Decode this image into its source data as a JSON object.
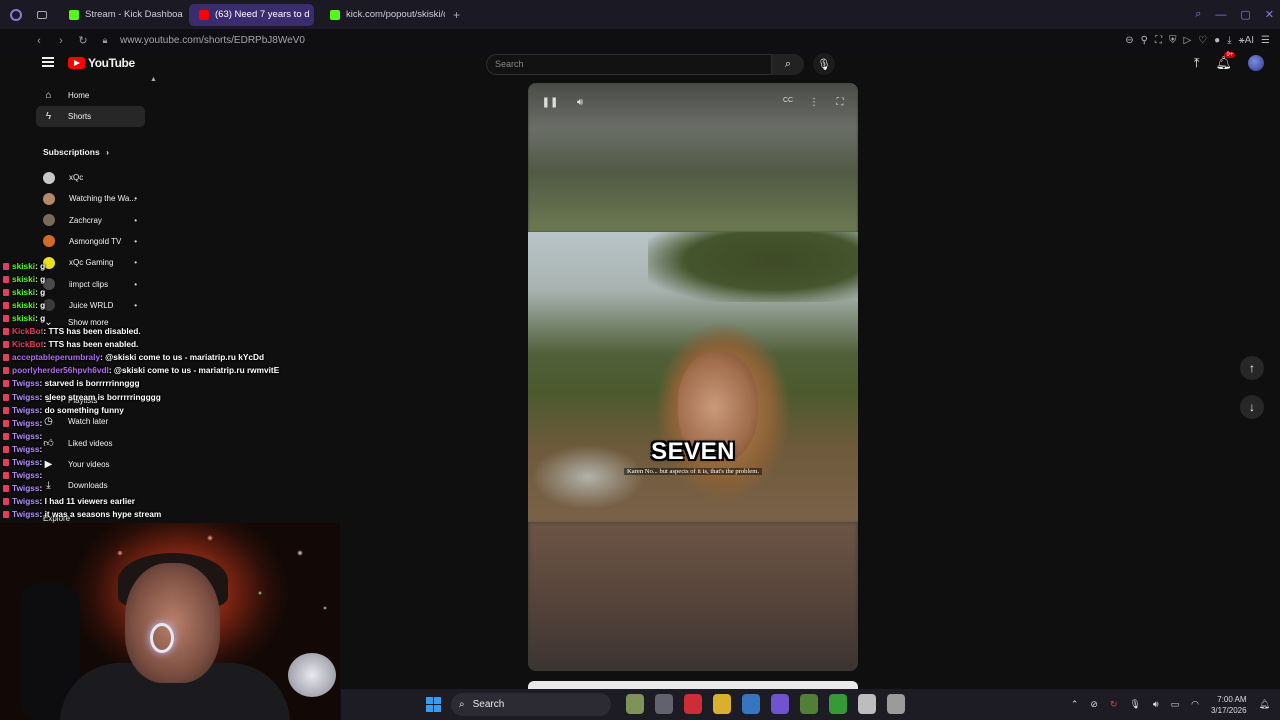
{
  "browser": {
    "tabs": [
      {
        "label": "Stream - Kick Dashboard",
        "color": "#53fc18",
        "active": false
      },
      {
        "label": "(63) Need 7 years to d",
        "color": "#ff0000",
        "active": true
      },
      {
        "label": "kick.com/popout/skiski/ch",
        "color": "#53fc18",
        "active": false
      }
    ],
    "new_tab": "+",
    "url": "www.youtube.com/shorts/EDRPbJ8WeV0",
    "ai_label": "AI"
  },
  "youtube": {
    "logo_text": "YouTube",
    "search_placeholder": "Search",
    "notification_count": "9+",
    "sidebar": {
      "main": [
        {
          "label": "Home",
          "icon": "home-icon",
          "glyph": "⌂"
        },
        {
          "label": "Shorts",
          "icon": "shorts-icon",
          "glyph": "ϟ"
        }
      ],
      "subscriptions_heading": "Subscriptions",
      "subscriptions": [
        {
          "label": "xQc",
          "color": "#c8c8c8"
        },
        {
          "label": "Watching the Wa...",
          "color": "#b58a6a"
        },
        {
          "label": "Zachcray",
          "color": "#7a6a5a"
        },
        {
          "label": "Asmongold TV",
          "color": "#d46a2a"
        },
        {
          "label": "xQc Gaming",
          "color": "#e8e020"
        },
        {
          "label": "iimpct clips",
          "color": "#4a4a4a"
        },
        {
          "label": "Juice WRLD",
          "color": "#3a3a3a"
        }
      ],
      "show_more": "Show more",
      "you_items": [
        {
          "label": "Playlists",
          "icon": "playlists-icon"
        },
        {
          "label": "Watch later",
          "icon": "watch-later-icon"
        },
        {
          "label": "Liked videos",
          "icon": "liked-videos-icon"
        },
        {
          "label": "Your videos",
          "icon": "your-videos-icon"
        },
        {
          "label": "Downloads",
          "icon": "downloads-icon"
        }
      ],
      "explore": "Explore"
    },
    "player": {
      "caption_big": "SEVEN",
      "subtitle": "Karen  No... but aspects of it is, that's the problem."
    }
  },
  "chat": {
    "messages": [
      {
        "user": "skiski",
        "text": "g",
        "color": "#53fc18"
      },
      {
        "user": "skiski",
        "text": "g",
        "color": "#53fc18"
      },
      {
        "user": "skiski",
        "text": "g",
        "color": "#53fc18"
      },
      {
        "user": "skiski",
        "text": "g",
        "color": "#53fc18"
      },
      {
        "user": "skiski",
        "text": "g",
        "color": "#53fc18"
      },
      {
        "user": "KickBot",
        "text": "TTS has been disabled.",
        "color": "#e0405e"
      },
      {
        "user": "KickBot",
        "text": "TTS has been enabled.",
        "color": "#e0405e"
      },
      {
        "user": "acceptableperumbraly",
        "text": "@skiski come to us - mariatrip.ru kYcDd",
        "color": "#b06cf5"
      },
      {
        "user": "poorlyherder56hpvh6vdl",
        "text": "@skiski come to us - mariatrip.ru rwmvitE",
        "color": "#b06cf5"
      },
      {
        "user": "Twigss",
        "text": "starved is borrrrrinnggg",
        "color": "#b38cff"
      },
      {
        "user": "Twigss",
        "text": "sleep stream is borrrrringggg",
        "color": "#b38cff"
      },
      {
        "user": "Twigss",
        "text": "do something funny",
        "color": "#b38cff"
      },
      {
        "user": "Twigss",
        "text": "",
        "color": "#b38cff"
      },
      {
        "user": "Twigss",
        "text": "",
        "color": "#b38cff"
      },
      {
        "user": "Twigss",
        "text": "",
        "color": "#b38cff"
      },
      {
        "user": "Twigss",
        "text": "",
        "color": "#b38cff"
      },
      {
        "user": "Twigss",
        "text": "",
        "color": "#b38cff"
      },
      {
        "user": "Twigss",
        "text": "",
        "color": "#b38cff"
      },
      {
        "user": "Twigss",
        "text": "I had 11 viewers earlier",
        "color": "#b38cff"
      },
      {
        "user": "Twigss",
        "text": "it was a seasons hype stream",
        "color": "#b38cff"
      }
    ]
  },
  "taskbar": {
    "search_label": "Search",
    "apps": [
      {
        "name": "widget-app-icon",
        "color": "#8aa060"
      },
      {
        "name": "file-explorer-gray-icon",
        "color": "#6a6a78"
      },
      {
        "name": "opera-icon",
        "color": "#e0303a"
      },
      {
        "name": "file-explorer-icon",
        "color": "#f0c030"
      },
      {
        "name": "store-icon",
        "color": "#3a80d0"
      },
      {
        "name": "opera-gx-icon",
        "color": "#7a5ae0"
      },
      {
        "name": "minecraft-icon",
        "color": "#5a8a3a"
      },
      {
        "name": "xbox-icon",
        "color": "#3aaa3a"
      },
      {
        "name": "obs-icon",
        "color": "#cfcfcf"
      },
      {
        "name": "settings-icon",
        "color": "#aaaaaa"
      }
    ],
    "time": "7:00 AM",
    "date": "3/17/2026"
  },
  "colors": {
    "accent": "#3a2c6e",
    "youtube_red": "#ff0000",
    "background": "#0f0f0f"
  }
}
